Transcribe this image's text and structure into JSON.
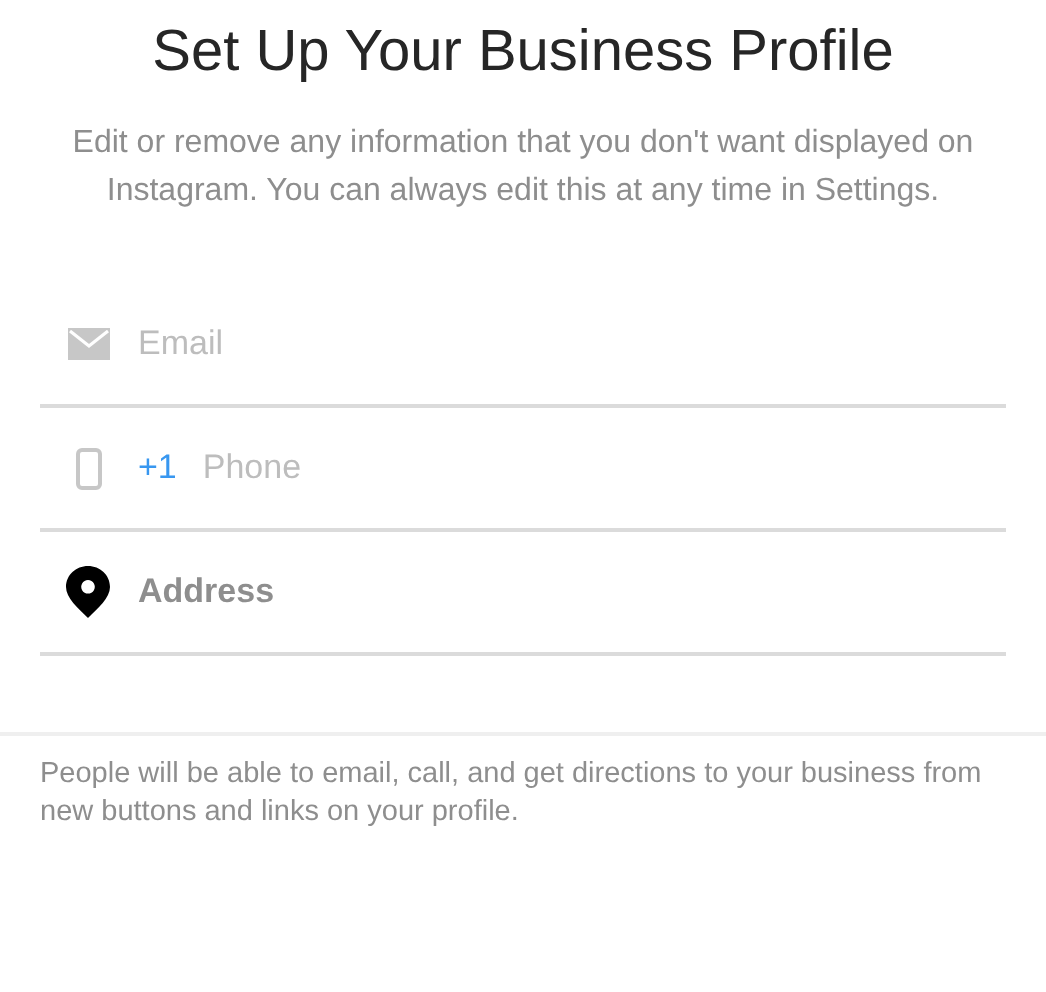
{
  "title": "Set Up Your Business Profile",
  "subtitle": "Edit or remove any information that you don't want displayed on Instagram. You can always edit this at any time in Settings.",
  "fields": [
    {
      "kind": "email",
      "placeholder": "Email"
    },
    {
      "kind": "phone",
      "prefix": "+1",
      "placeholder": "Phone"
    },
    {
      "kind": "address",
      "label": "Address"
    }
  ],
  "footer": "People will be able to email, call, and get directions to your business from new buttons and links on your profile."
}
